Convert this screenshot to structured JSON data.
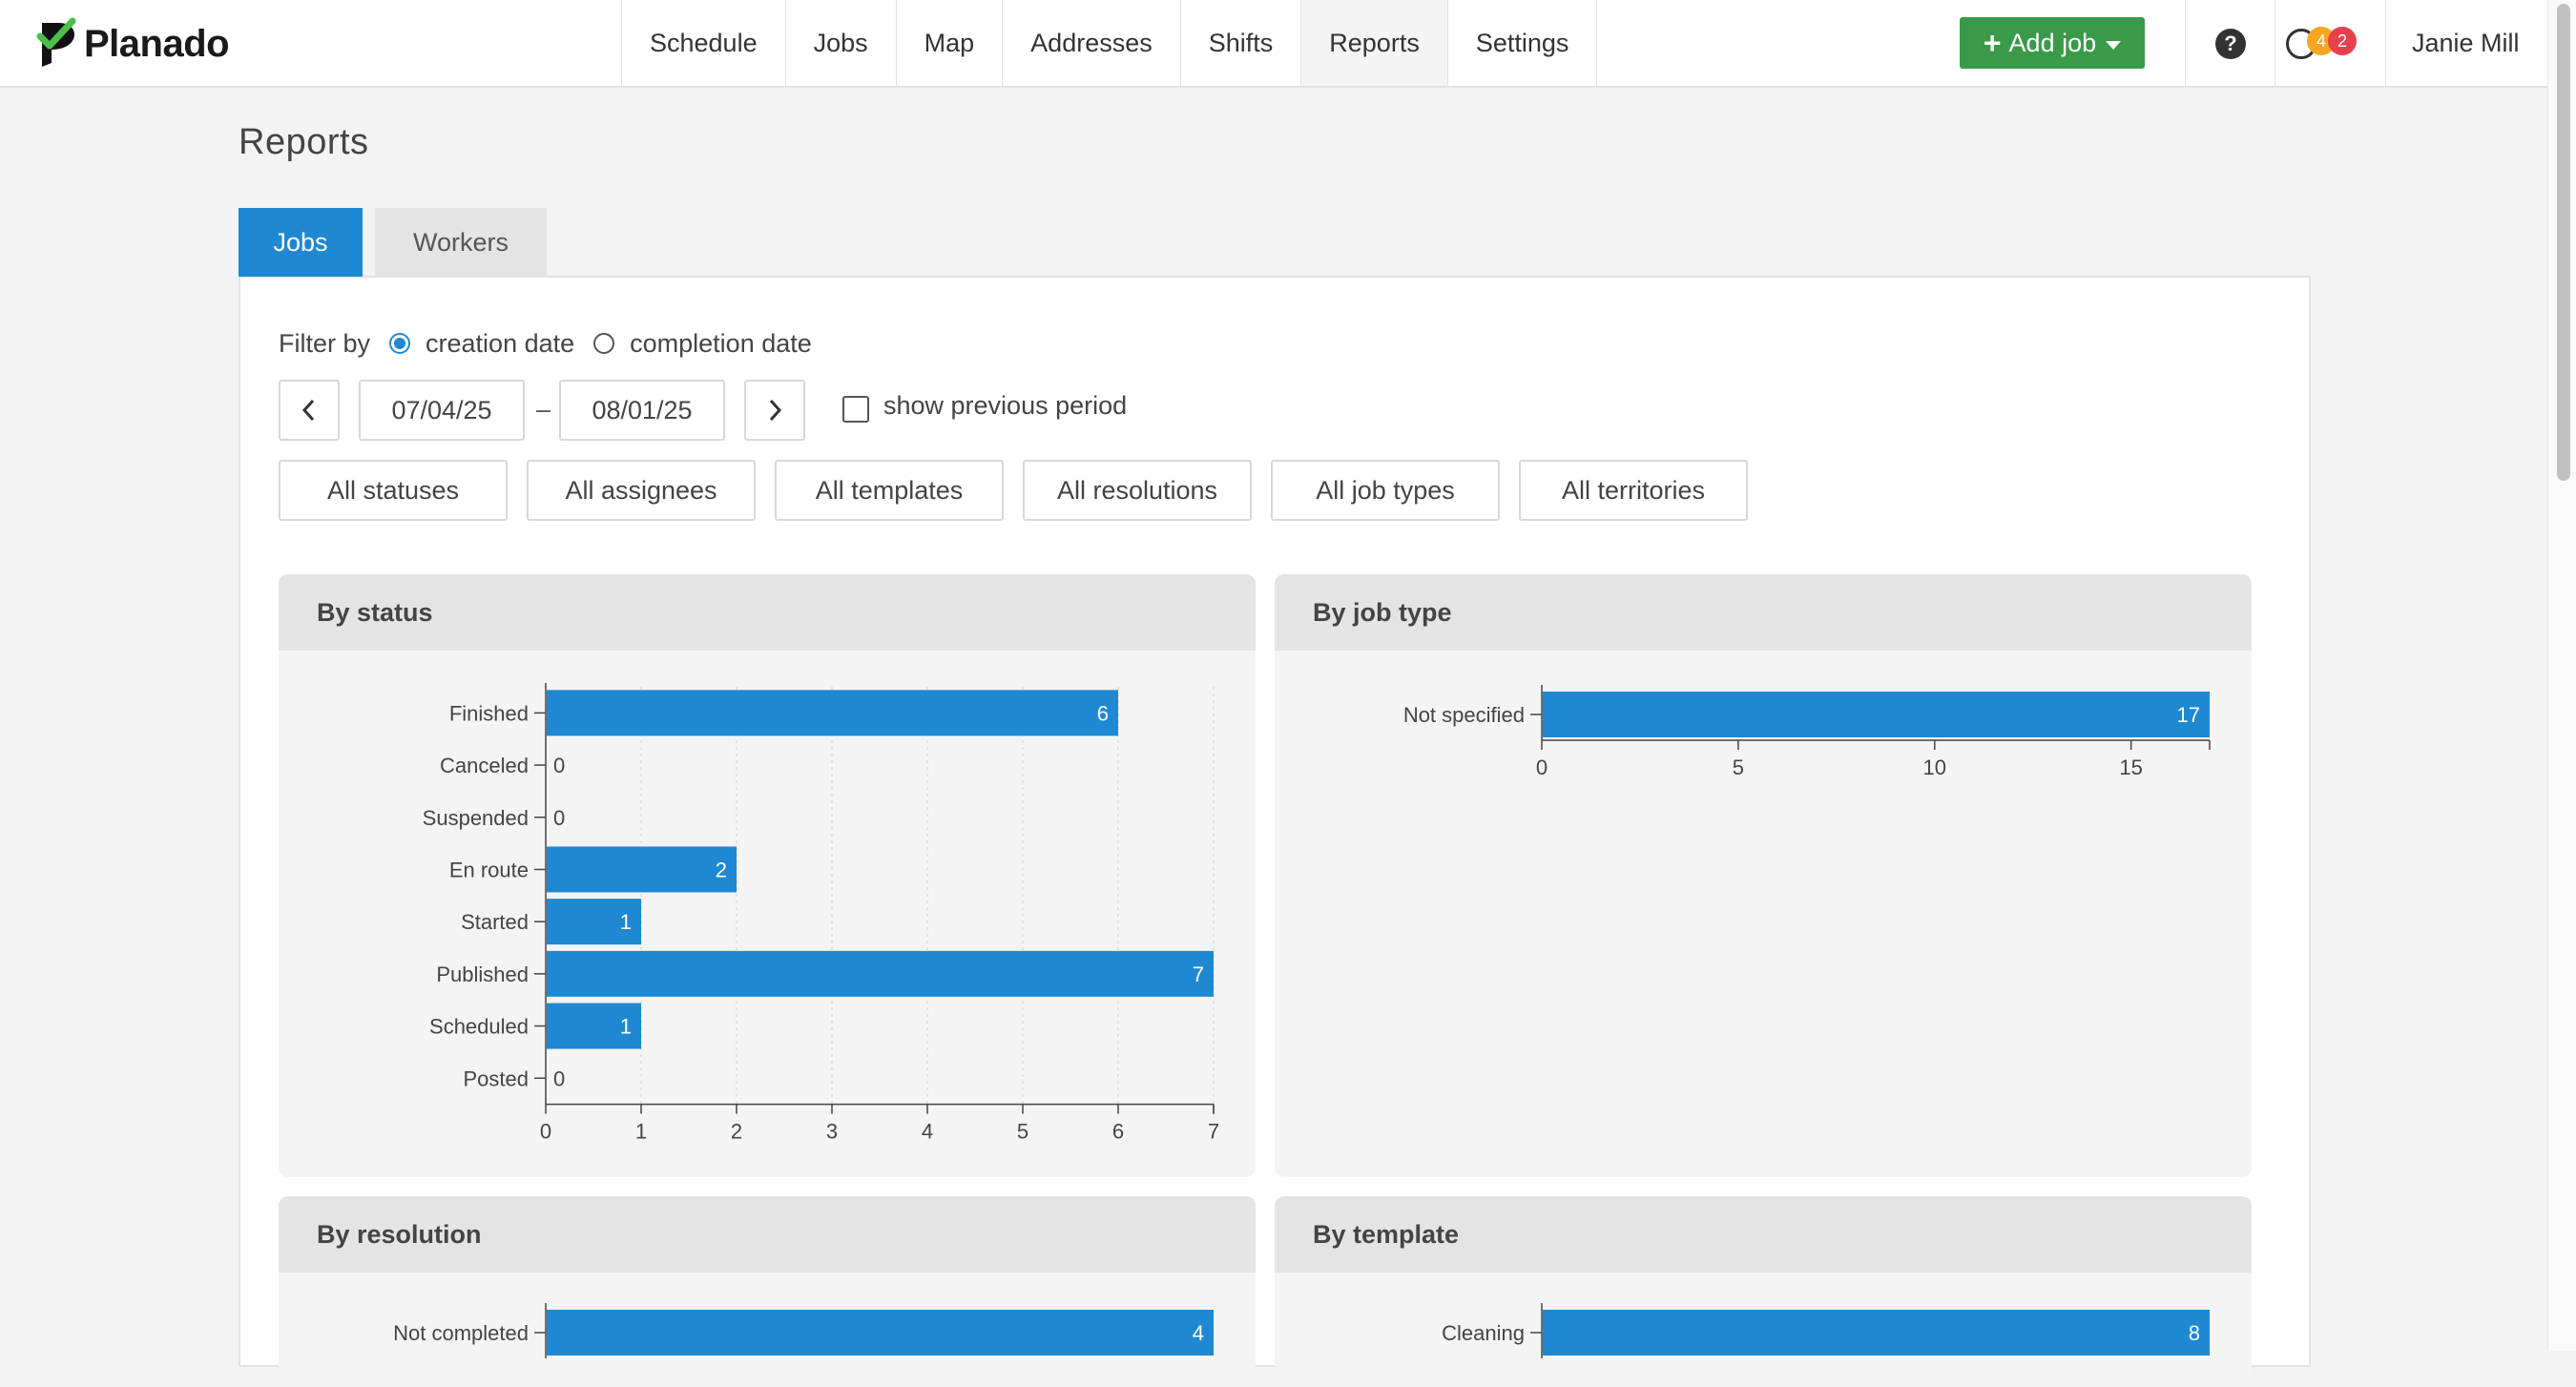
{
  "app": {
    "logo_text": "Planado",
    "user_name": "Janie Mill"
  },
  "nav": [
    {
      "label": "Schedule",
      "active": false
    },
    {
      "label": "Jobs",
      "active": false
    },
    {
      "label": "Map",
      "active": false
    },
    {
      "label": "Addresses",
      "active": false
    },
    {
      "label": "Shifts",
      "active": false
    },
    {
      "label": "Reports",
      "active": true
    },
    {
      "label": "Settings",
      "active": false
    }
  ],
  "header": {
    "add_job_label": "Add job",
    "help_glyph": "?",
    "badges": [
      "4",
      "2"
    ]
  },
  "page": {
    "title": "Reports",
    "tabs": {
      "jobs": "Jobs",
      "workers": "Workers"
    }
  },
  "filters": {
    "filter_by_label": "Filter by",
    "creation_date_label": "creation date",
    "completion_date_label": "completion date",
    "date_from": "07/04/25",
    "date_separator": "–",
    "date_to": "08/01/25",
    "show_previous_label": "show previous period",
    "dropdowns": {
      "statuses": "All statuses",
      "assignees": "All assignees",
      "templates": "All templates",
      "resolutions": "All resolutions",
      "job_types": "All job types",
      "territories": "All territories"
    }
  },
  "colors": {
    "accent": "#1f88d2",
    "add_job": "#3a9a4a",
    "bar": "#1f88d2"
  },
  "icons": [
    "planado-logo-icon",
    "chevron-left-icon",
    "chevron-right-icon",
    "help-icon",
    "notifications-icon",
    "caret-down-icon"
  ],
  "chart_data": [
    {
      "title": "By status",
      "type": "bar",
      "orientation": "horizontal",
      "categories": [
        "Finished",
        "Canceled",
        "Suspended",
        "En route",
        "Started",
        "Published",
        "Scheduled",
        "Posted"
      ],
      "values": [
        6,
        0,
        0,
        2,
        1,
        7,
        1,
        0
      ],
      "xlim": [
        0,
        7
      ],
      "ticks": [
        0,
        1,
        2,
        3,
        4,
        5,
        6,
        7
      ],
      "grid": true
    },
    {
      "title": "By job type",
      "type": "bar",
      "orientation": "horizontal",
      "categories": [
        "Not specified"
      ],
      "values": [
        17
      ],
      "xlim": [
        0,
        17
      ],
      "ticks": [
        0,
        5,
        10,
        15
      ],
      "grid": false
    },
    {
      "title": "By resolution",
      "type": "bar",
      "orientation": "horizontal",
      "categories": [
        "Not completed"
      ],
      "values": [
        4
      ],
      "xlim": [
        0,
        4
      ]
    },
    {
      "title": "By template",
      "type": "bar",
      "orientation": "horizontal",
      "categories": [
        "Cleaning"
      ],
      "values": [
        8
      ],
      "xlim": [
        0,
        8
      ]
    }
  ]
}
